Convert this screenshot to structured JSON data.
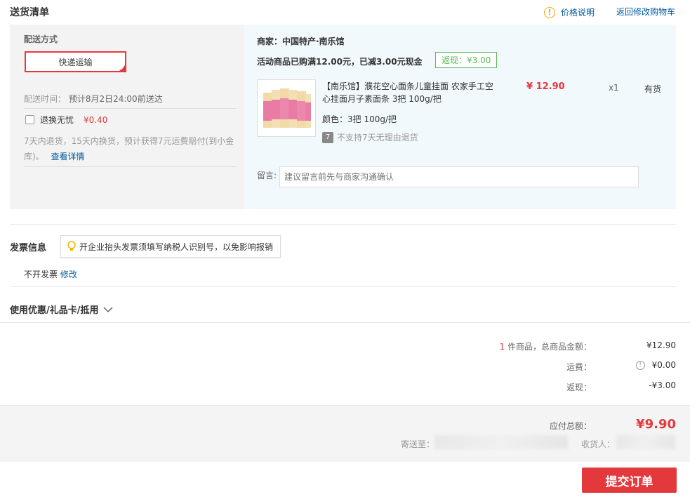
{
  "header": {
    "title": "送货清单",
    "price_info": "价格说明",
    "back_cart": "返回修改购物车"
  },
  "shipping": {
    "method_label": "配送方式",
    "method_value": "快递运输",
    "time_label": "配送时间：",
    "time_value": "预计8月2日24:00前送达",
    "return_service": "退换无忧",
    "return_price": "¥0.40",
    "return_note": "7天内退货，15天内换货，预计获得7元运费赔付(到小金库)。",
    "detail_link": "查看详情"
  },
  "merchant": {
    "name": "商家：中国特产·南乐馆",
    "promo": "活动商品已购满12.00元，已减3.00元现金",
    "cashback": "返现：¥3.00",
    "product_title": "【南乐馆】濮花空心面条儿童挂面 农家手工空心挂面月子素面条 3把 100g/把",
    "product_color": "颜色：3把 100g/把",
    "no_return_icon_text": "7",
    "no_return": "不支持7天无理由退货",
    "price": "¥ 12.90",
    "qty": "x1",
    "stock": "有货",
    "message_label": "留言:",
    "message_placeholder": "建议留言前先与商家沟通确认"
  },
  "invoice": {
    "title": "发票信息",
    "tip": "开企业抬头发票须填写纳税人识别号，以免影响报销",
    "value": "不开发票",
    "edit": "修改"
  },
  "coupon": {
    "label": "使用优惠/礼品卡/抵用"
  },
  "summary": {
    "count": "1",
    "count_suffix": "件商品，总商品金额：",
    "goods_total": "¥12.90",
    "freight_label": "运费：",
    "freight": "¥0.00",
    "cashback_label": "返现：",
    "cashback": "-¥3.00",
    "payable_label": "应付总额：",
    "payable": "¥9.90",
    "ship_to_label": "寄送至：",
    "receiver_label": "收货人："
  },
  "submit": "提交订单",
  "colors": {
    "accent": "#e4393c",
    "link": "#005aa0",
    "cashback_green": "#5cb85c"
  }
}
